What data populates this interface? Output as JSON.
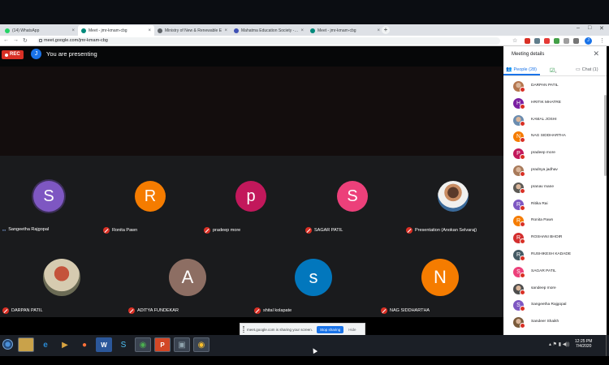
{
  "browser": {
    "tabs": [
      {
        "label": "(14) WhatsApp",
        "fav_color": "#25d366"
      },
      {
        "label": "Meet - jmr-kmam-cbg",
        "fav_color": "#00897b",
        "active": true
      },
      {
        "label": "Ministry of New & Renewable E",
        "fav_color": "#5f6368"
      },
      {
        "label": "Mahatma Education Society - Co",
        "fav_color": "#3f51b5"
      },
      {
        "label": "Meet - jmr-kmam-cbg",
        "fav_color": "#00897b"
      }
    ],
    "new_tab": "+",
    "url": "meet.google.com/jmr-kmam-cbg",
    "win_controls": [
      "–",
      "□",
      "✕"
    ],
    "profile_initial": "J"
  },
  "meet": {
    "rec_label": "REC",
    "presenter_initial": "J",
    "presenting_text": "You are presenting",
    "tiles": [
      {
        "name": "Sangeetha Rajgopal",
        "initial": "S",
        "color": "#7e57c2",
        "sound": true
      },
      {
        "name": "Ronita Pawn",
        "initial": "R",
        "color": "#f57c00"
      },
      {
        "name": "pradeep more",
        "initial": "p",
        "color": "#c2185b"
      },
      {
        "name": "SAGAR PATIL",
        "initial": "S",
        "color": "#ec407a"
      },
      {
        "name": "Presentation (Anokan Selvaraj)",
        "initial": "",
        "color": "#4a6b8a",
        "photo": true
      },
      {
        "name": "DARPAN PATIL",
        "initial": "",
        "color": "#c4533b",
        "photo": true
      },
      {
        "name": "ADITYA FUNDEKAR",
        "initial": "A",
        "color": "#8d6e63"
      },
      {
        "name": "shital kolapate",
        "initial": "s",
        "color": "#0277bd"
      },
      {
        "name": "NAG SIDDHARTHA",
        "initial": "N",
        "color": "#f57c00"
      }
    ]
  },
  "panel": {
    "title": "Meeting details",
    "close_icon": "✕",
    "tabs": {
      "people": "People (28)",
      "tasks_count": "1",
      "chat": "Chat (1)"
    },
    "people": [
      {
        "name": "DARPAN PATIL",
        "initial": "",
        "color": "#b5764e",
        "photo": true
      },
      {
        "name": "HRITIK MHATRE",
        "initial": "H",
        "color": "#7b1fa2"
      },
      {
        "name": "KAMAL JOSHI",
        "initial": "",
        "color": "#6a8caf",
        "photo": true
      },
      {
        "name": "NAG SIDDHARTHA",
        "initial": "N",
        "color": "#f57c00"
      },
      {
        "name": "pradeep more",
        "initial": "P",
        "color": "#c2185b"
      },
      {
        "name": "pradnya jadhav",
        "initial": "",
        "color": "#a87a5a",
        "photo": true
      },
      {
        "name": "pranav mane",
        "initial": "",
        "color": "#5d5a55",
        "photo": true
      },
      {
        "name": "Ritika Rai",
        "initial": "R",
        "color": "#7e57c2"
      },
      {
        "name": "Ronita Pawn",
        "initial": "R",
        "color": "#f57c00"
      },
      {
        "name": "ROSHANI BHOIR",
        "initial": "R",
        "color": "#d32f2f"
      },
      {
        "name": "RUSHIKESH KADADE",
        "initial": "R",
        "color": "#455a64"
      },
      {
        "name": "SAGAR PATIL",
        "initial": "S",
        "color": "#ec407a"
      },
      {
        "name": "sandeep more",
        "initial": "",
        "color": "#4e4e4e",
        "photo": true
      },
      {
        "name": "Sangeetha Rajgopal",
        "initial": "S",
        "color": "#7e57c2"
      },
      {
        "name": "Sandeer Shaikh",
        "initial": "",
        "color": "#7a5a3a",
        "photo": true
      }
    ]
  },
  "sharebar": {
    "text": "meet.google.com is sharing your screen.",
    "stop": "Stop sharing",
    "hide": "Hide"
  },
  "taskbar": {
    "time": "12:25 PM",
    "date": "7/4/2020"
  }
}
